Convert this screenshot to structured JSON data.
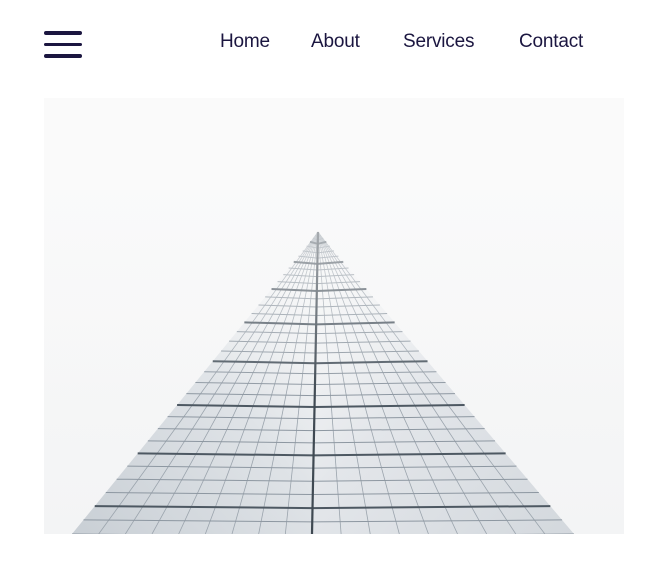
{
  "header": {
    "menu_icon": "hamburger-menu-icon",
    "nav": [
      {
        "label": "Home"
      },
      {
        "label": "About"
      },
      {
        "label": "Services"
      },
      {
        "label": "Contact"
      }
    ]
  },
  "hero": {
    "image": "glass-skyscraper-corner-photo"
  },
  "colors": {
    "text": "#1b1640",
    "background": "#ffffff",
    "sky": "#fafafa"
  }
}
